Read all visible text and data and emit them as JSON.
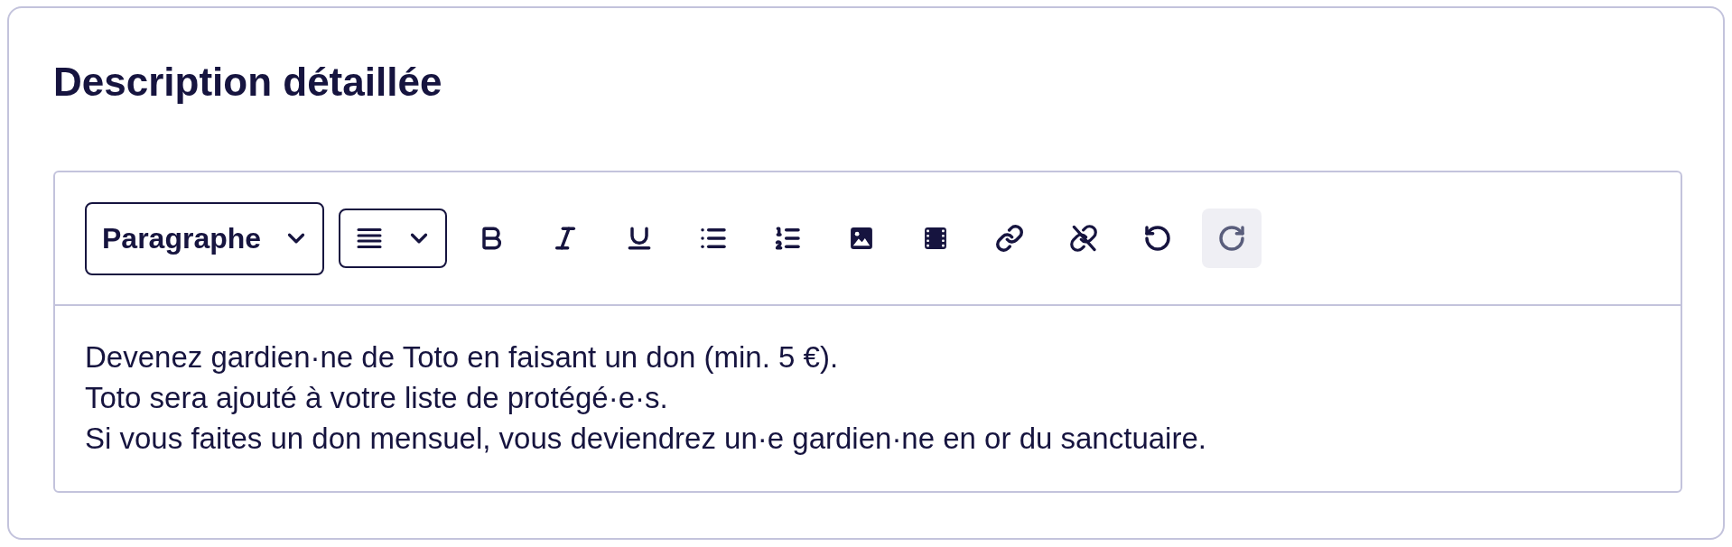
{
  "card": {
    "title": "Description détaillée"
  },
  "editor": {
    "toolbar": {
      "block_format": {
        "value": "Paragraphe"
      },
      "alignment": {
        "kind": "justify"
      },
      "tools": [
        {
          "kind": "bold",
          "disabled": false
        },
        {
          "kind": "italic",
          "disabled": false
        },
        {
          "kind": "underline",
          "disabled": false
        },
        {
          "kind": "bulleted_list",
          "disabled": false
        },
        {
          "kind": "numbered_list",
          "disabled": false
        },
        {
          "kind": "image",
          "disabled": false
        },
        {
          "kind": "video",
          "disabled": false
        },
        {
          "kind": "link",
          "disabled": false
        },
        {
          "kind": "unlink",
          "disabled": false
        },
        {
          "kind": "undo",
          "disabled": false
        },
        {
          "kind": "redo",
          "disabled": true
        }
      ]
    },
    "content": {
      "lines": [
        "Devenez gardien·ne de Toto en faisant un don (min. 5 €).",
        "Toto sera ajouté à votre liste de protégé·e·s.",
        "Si vous faites un don mensuel, vous deviendrez un·e gardien·ne en or du sanctuaire."
      ]
    }
  }
}
